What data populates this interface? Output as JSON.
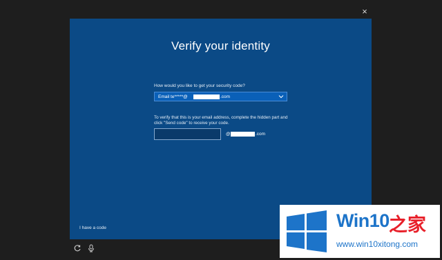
{
  "window": {
    "close_glyph": "×"
  },
  "dialog": {
    "title": "Verify your identity",
    "question_label": "How would you like to get your security code?",
    "method_select": {
      "prefix": "Email te*****@",
      "suffix": ".com",
      "chevron": "chevron-down-icon"
    },
    "verify_instructions": "To verify that this is your email address, complete the hidden part and click \"Send code\" to receive your code.",
    "code_input": {
      "value": "",
      "placeholder": ""
    },
    "domain_suffix": {
      "at": "@",
      "com": ".com"
    },
    "have_code_link": "I have a code"
  },
  "footer_icons": [
    "ease-of-access-icon",
    "microphone-icon"
  ],
  "watermark": {
    "brand": "Win10",
    "brand_cn": "之家",
    "url": "www.win10xitong.com"
  },
  "colors": {
    "background": "#1e1e1e",
    "dialog": "#0b4a86",
    "select": "#0a60b8",
    "watermark_blue": "#1d74c9",
    "watermark_red": "#e8202a"
  }
}
